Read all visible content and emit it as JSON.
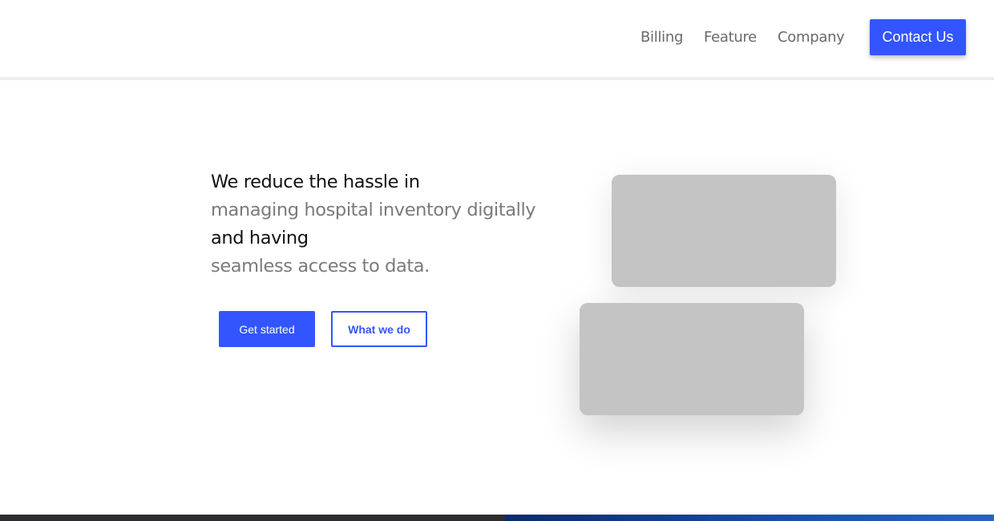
{
  "nav": {
    "links": [
      "Billing",
      "Feature",
      "Company"
    ],
    "cta_label": "Contact Us"
  },
  "hero": {
    "lines": [
      {
        "text": "We reduce the hassle in",
        "tone": "dark"
      },
      {
        "text": "managing hospital inventory digitally",
        "tone": "grey"
      },
      {
        "text": "and having",
        "tone": "dark"
      },
      {
        "text": "seamless access to data.",
        "tone": "grey"
      }
    ],
    "primary_button": "Get started",
    "secondary_button": "What we do"
  },
  "colors": {
    "accent": "#3355ff",
    "text_dark": "#111111",
    "text_grey": "#7a7a7a",
    "placeholder": "#c4c4c4"
  }
}
